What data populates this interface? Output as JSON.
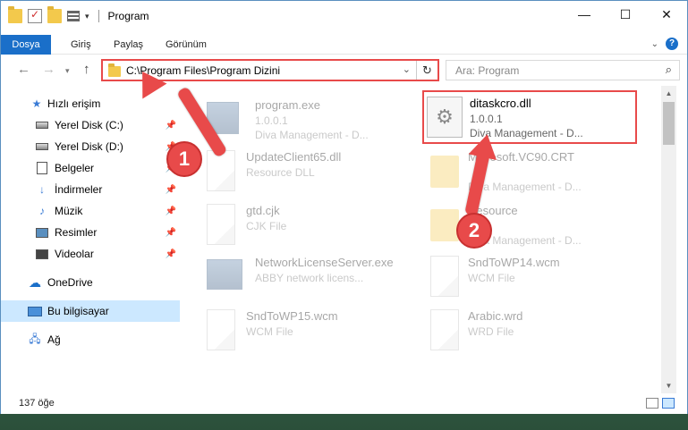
{
  "window": {
    "title": "Program",
    "controls": [
      "minimize",
      "maximize",
      "close"
    ]
  },
  "ribbon": {
    "tabs": [
      "Dosya",
      "Giriş",
      "Paylaş",
      "Görünüm"
    ],
    "help_label": "?"
  },
  "navigation": {
    "address": "C:\\Program Files\\Program Dizini",
    "search_placeholder": "Ara: Program"
  },
  "sidebar": {
    "items": [
      {
        "label": "Hızlı erişim",
        "icon": "star-icon"
      },
      {
        "label": "Yerel Disk (C:)",
        "icon": "drive-icon",
        "pinned": true
      },
      {
        "label": "Yerel Disk (D:)",
        "icon": "drive-icon",
        "pinned": true
      },
      {
        "label": "Belgeler",
        "icon": "documents-icon",
        "pinned": true
      },
      {
        "label": "İndirmeler",
        "icon": "download-icon",
        "pinned": true
      },
      {
        "label": "Müzik",
        "icon": "music-icon",
        "pinned": true
      },
      {
        "label": "Resimler",
        "icon": "pictures-icon",
        "pinned": true
      },
      {
        "label": "Videolar",
        "icon": "videos-icon",
        "pinned": true
      },
      {
        "label": "OneDrive",
        "icon": "cloud-icon"
      },
      {
        "label": "Bu bilgisayar",
        "icon": "computer-icon",
        "selected": true
      },
      {
        "label": "Ağ",
        "icon": "network-icon"
      }
    ]
  },
  "files": [
    {
      "name": "program.exe",
      "line1": "1.0.0.1",
      "line2": "Diva Management - D...",
      "icon": "exe-icon"
    },
    {
      "name": "ditaskcro.dll",
      "line1": "1.0.0.1",
      "line2": "Diva Management - D...",
      "icon": "gear-file-icon"
    },
    {
      "name": "UpdateClient65.dll",
      "line1": "Resource DLL",
      "line2": "",
      "icon": "file-icon"
    },
    {
      "name": "Microsoft.VC90.CRT",
      "line1": "",
      "line2": "Diva Management - D...",
      "icon": "folder-icon"
    },
    {
      "name": "gtd.cjk",
      "line1": "CJK File",
      "line2": "",
      "icon": "file-icon"
    },
    {
      "name": "Resource",
      "line1": "",
      "line2": "Diva Management - D...",
      "icon": "folder-icon"
    },
    {
      "name": "NetworkLicenseServer.exe",
      "line1": "ABBY network licens...",
      "line2": "",
      "icon": "exe-icon"
    },
    {
      "name": "SndToWP14.wcm",
      "line1": "WCM File",
      "line2": "",
      "icon": "file-icon"
    },
    {
      "name": "SndToWP15.wcm",
      "line1": "WCM File",
      "line2": "",
      "icon": "file-icon"
    },
    {
      "name": "Arabic.wrd",
      "line1": "WRD File",
      "line2": "",
      "icon": "file-icon"
    }
  ],
  "status": {
    "item_count": "137 öğe"
  },
  "annotations": {
    "badge1": "1",
    "badge2": "2"
  }
}
